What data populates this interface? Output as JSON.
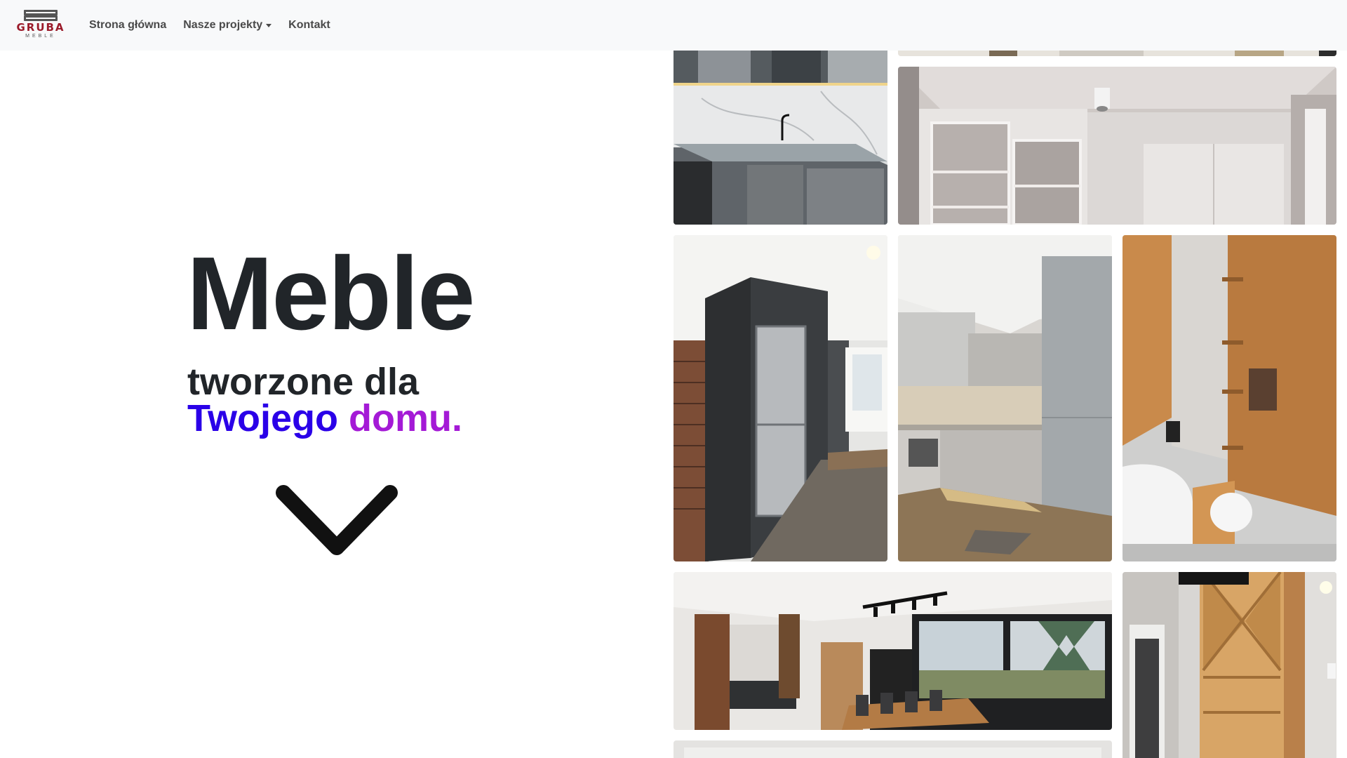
{
  "navbar": {
    "brand": {
      "name": "GRUBA",
      "sub": "MEBLE"
    },
    "links": [
      {
        "label": "Strona główna"
      },
      {
        "label": "Nasze projekty"
      },
      {
        "label": "Kontakt"
      }
    ]
  },
  "hero": {
    "title": "Meble",
    "line1": "tworzone dla",
    "line2_word1": "Twojego",
    "line2_word2": "domu."
  },
  "colors": {
    "accent_blue": "#2a00e8",
    "accent_purple": "#a41ad6",
    "brand_red": "#9b1b2a",
    "navbar_bg": "#f8f9fa"
  },
  "icons": {
    "scroll": "chevron-down-icon"
  }
}
